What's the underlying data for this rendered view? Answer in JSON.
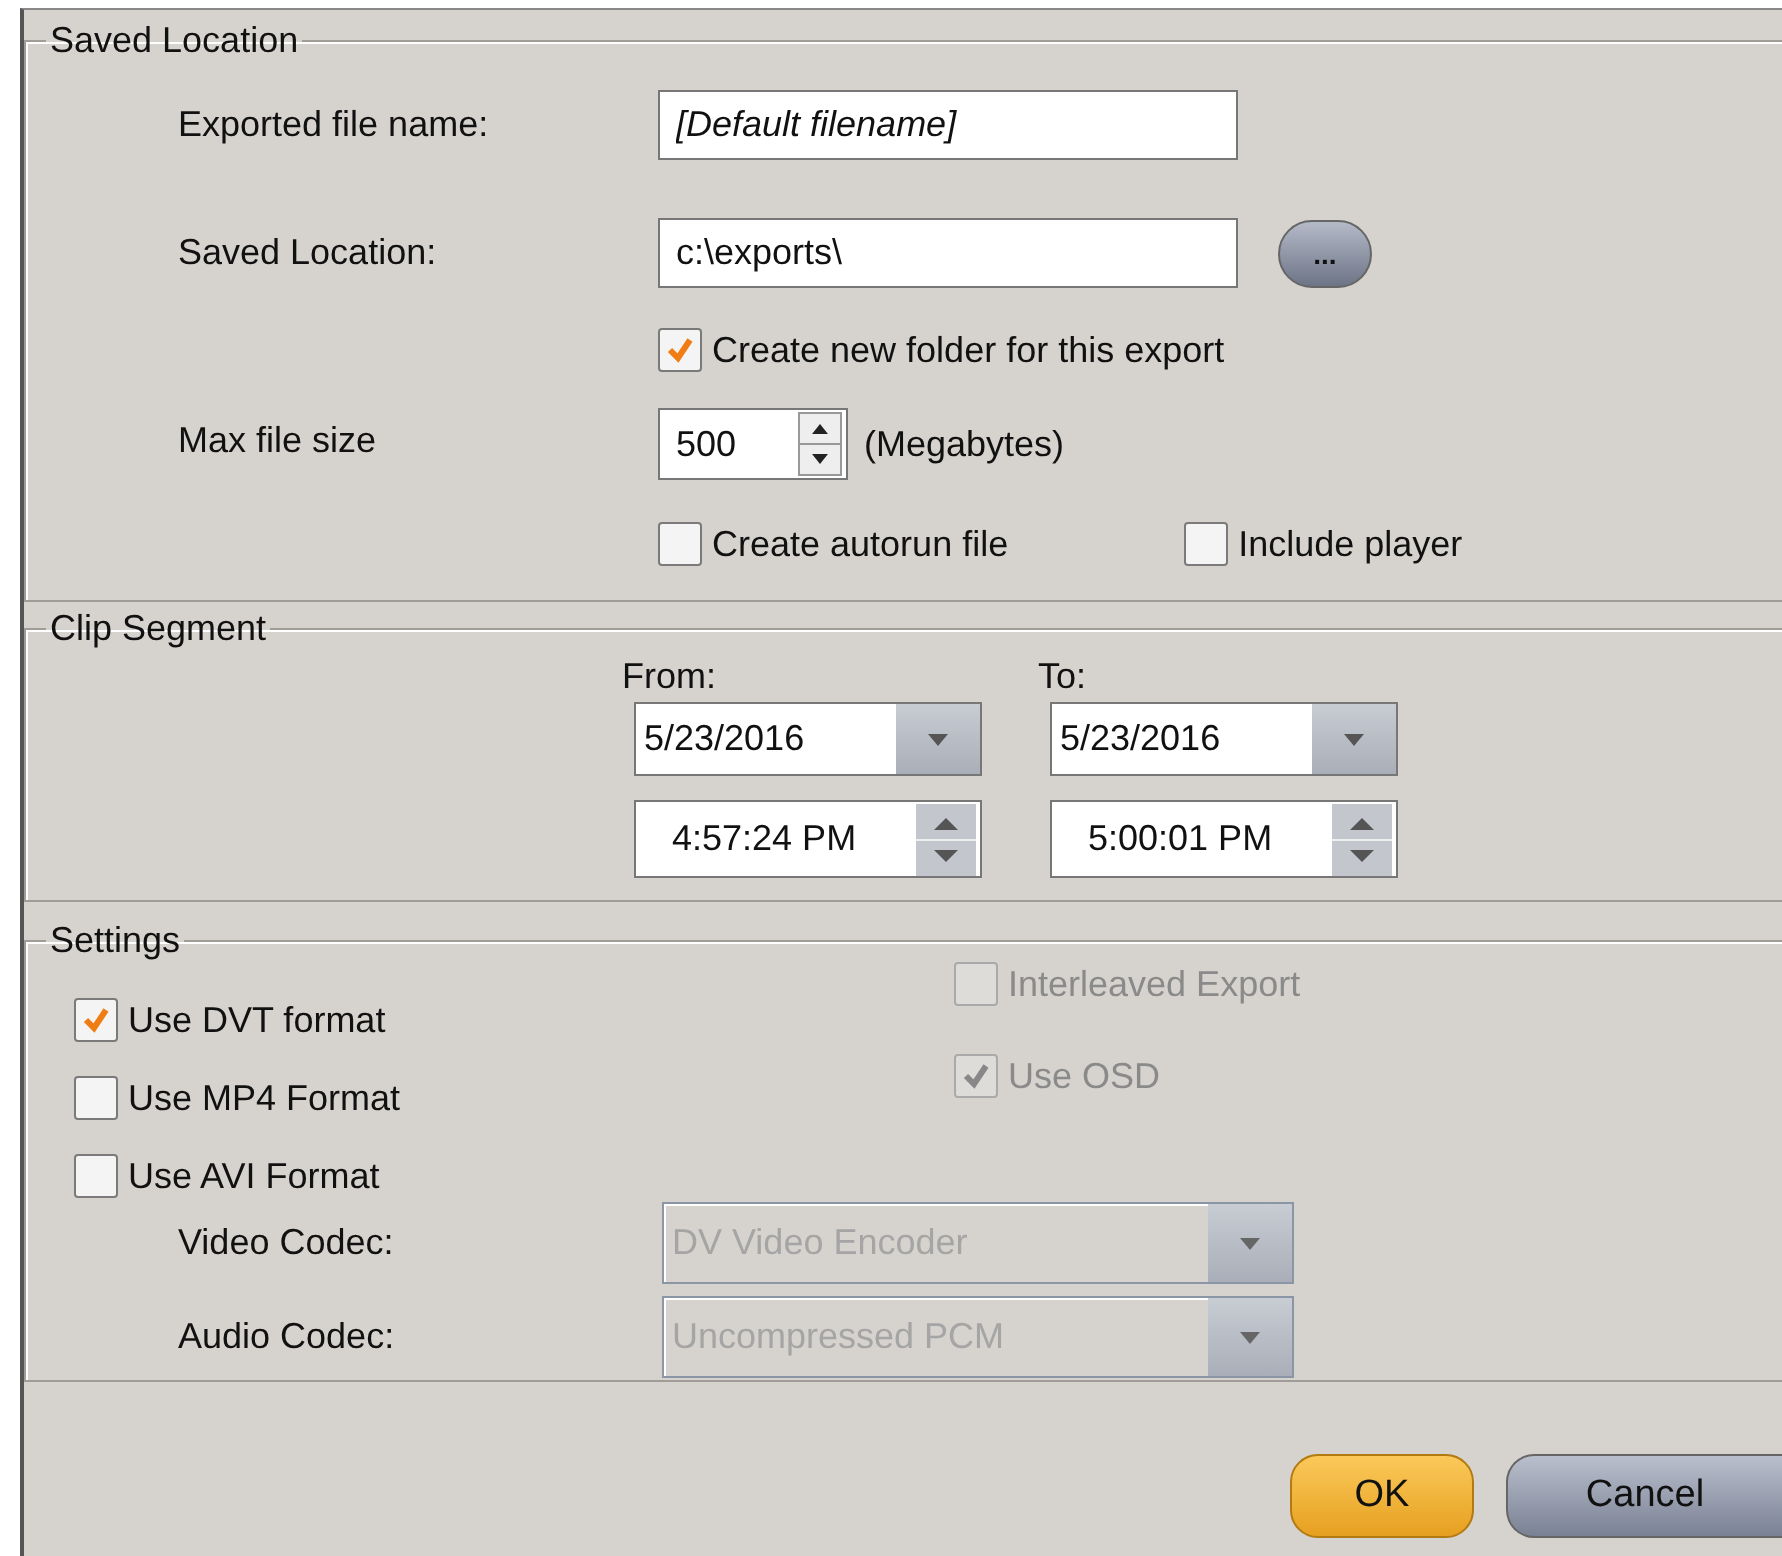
{
  "saved_location": {
    "title": "Saved Location",
    "file_name": {
      "label": "Exported file name:",
      "placeholder": "[Default filename]"
    },
    "location": {
      "label": "Saved Location:",
      "value": "c:\\exports\\",
      "browse_label": "..."
    },
    "new_folder": {
      "label": "Create new folder for this export",
      "checked": true
    },
    "max_size": {
      "label": "Max file size",
      "value": "500",
      "unit": "(Megabytes)"
    },
    "options": [
      {
        "label": "Create autorun file",
        "checked": false
      },
      {
        "label": "Include player",
        "checked": false
      }
    ]
  },
  "clip_segment": {
    "title": "Clip Segment",
    "ranges": [
      {
        "label": "From:",
        "date": "5/23/2016",
        "time": "4:57:24 PM"
      },
      {
        "label": "To:",
        "date": "5/23/2016",
        "time": "5:00:01 PM"
      }
    ]
  },
  "settings": {
    "title": "Settings",
    "formats": [
      {
        "label": "Use DVT format",
        "checked": true,
        "disabled": false
      },
      {
        "label": "Use MP4 Format",
        "checked": false,
        "disabled": false
      },
      {
        "label": "Use AVI Format",
        "checked": false,
        "disabled": false
      }
    ],
    "options": [
      {
        "label": "Interleaved Export",
        "checked": false,
        "disabled": true
      },
      {
        "label": "Use OSD",
        "checked": true,
        "disabled": true
      }
    ],
    "codecs": [
      {
        "label": "Video Codec:",
        "value": "DV Video Encoder",
        "disabled": true
      },
      {
        "label": "Audio Codec:",
        "value": "Uncompressed PCM",
        "disabled": true
      }
    ]
  },
  "buttons": [
    {
      "label": "OK",
      "kind": "primary"
    },
    {
      "label": "Cancel",
      "kind": "secondary"
    }
  ]
}
